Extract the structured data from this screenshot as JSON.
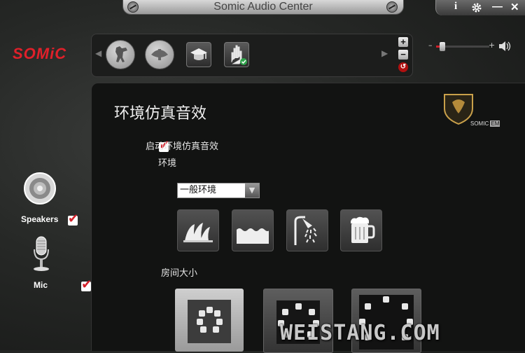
{
  "window": {
    "title": "Somic Audio Center"
  },
  "controls": {
    "info": "i",
    "minimize": "—",
    "close": "✕"
  },
  "brand": {
    "logo": "SOMiC",
    "badge": "SOMIC",
    "badge_suffix": "EM",
    "accent": "#e0202a"
  },
  "profile_bar": {
    "icons": [
      "counter-strike-icon",
      "mortal-kombat-icon",
      "graduation-cap-icon",
      "hand-icon"
    ],
    "add": "+",
    "remove": "−"
  },
  "volume": {
    "minus": "–",
    "plus": "+",
    "level": 0.12
  },
  "sidebar": {
    "items": [
      {
        "label": "Speakers",
        "checked": true
      },
      {
        "label": "Mic",
        "checked": true
      }
    ]
  },
  "main": {
    "title": "环境仿真音效",
    "enable_label": "启动环境仿真音效",
    "environment_label": "环境",
    "environment_value": "一般环境",
    "environments": [
      "opera-house-icon",
      "water-icon",
      "shower-icon",
      "beer-mug-icon"
    ],
    "room_size_label": "房间大小",
    "room_sizes": [
      "small-room",
      "medium-room",
      "large-room"
    ]
  },
  "watermark": "WEISTANG.COM"
}
